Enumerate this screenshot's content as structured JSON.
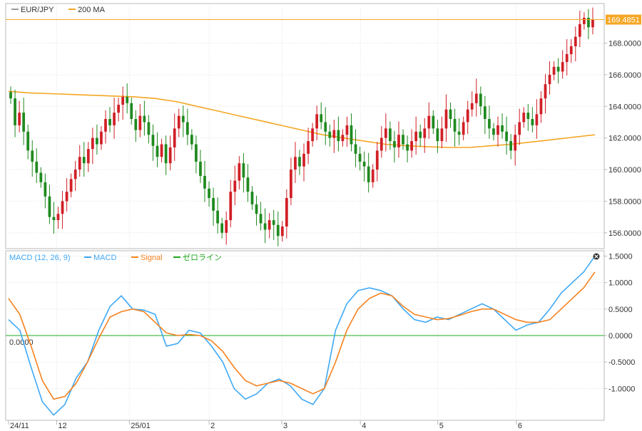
{
  "colors": {
    "background": "#ffffff",
    "grid": "#e0e0e0",
    "border": "#b8b8b8",
    "candle_up": "#d11f26",
    "candle_down": "#1f8a1f",
    "ma": "#f5a623",
    "macd": "#3fa9f5",
    "signal": "#f58220",
    "zero": "#22aa22",
    "price_tag_bg": "#f5a623",
    "price_tag_fg": "#ffffff"
  },
  "chart_data": [
    {
      "type": "candlestick",
      "legend": [
        {
          "label": "EUR/JPY",
          "color": "#9a9a9a"
        },
        {
          "label": "200 MA",
          "color": "#f5a623"
        }
      ],
      "ylim": [
        155,
        170.5
      ],
      "yticks": [
        "168.0000",
        "166.0000",
        "164.0000",
        "162.0000",
        "160.0000",
        "158.0000",
        "156.0000"
      ],
      "ytick_values": [
        168,
        166,
        164,
        162,
        160,
        158,
        156
      ],
      "last_price": "169.4851",
      "last_price_value": 169.4851,
      "closes": [
        164.5,
        162.8,
        163.6,
        162.4,
        161.2,
        160.5,
        159.8,
        159.2,
        158.3,
        157.0,
        156.8,
        157.2,
        158.0,
        158.6,
        159.4,
        160.0,
        160.8,
        160.4,
        161.3,
        162.0,
        161.6,
        162.4,
        163.2,
        162.8,
        163.6,
        164.1,
        164.6,
        164.2,
        163.2,
        162.5,
        163.4,
        163.0,
        162.2,
        161.5,
        160.8,
        161.6,
        160.4,
        161.4,
        162.6,
        163.4,
        163.0,
        162.2,
        161.6,
        160.5,
        159.6,
        158.8,
        158.2,
        157.4,
        156.6,
        156.0,
        156.8,
        158.6,
        159.3,
        160.4,
        159.5,
        158.6,
        157.8,
        157.2,
        156.6,
        156.2,
        156.8,
        156.5,
        155.8,
        156.4,
        158.2,
        160.0,
        160.8,
        160.2,
        161.0,
        161.8,
        162.6,
        163.5,
        163.0,
        162.4,
        162.0,
        162.5,
        161.8,
        162.2,
        162.8,
        161.6,
        161.0,
        160.5,
        160.2,
        159.2,
        160.0,
        161.2,
        162.0,
        162.6,
        161.8,
        161.4,
        162.2,
        161.6,
        161.2,
        161.8,
        162.4,
        162.0,
        162.6,
        163.4,
        162.6,
        161.8,
        162.6,
        163.8,
        163.2,
        162.4,
        162.2,
        163.0,
        163.8,
        164.2,
        164.8,
        164.0,
        163.2,
        162.6,
        162.2,
        162.8,
        162.4,
        161.8,
        161.2,
        162.2,
        163.0,
        163.6,
        163.2,
        162.8,
        163.5,
        164.5,
        165.4,
        166.0,
        166.5,
        166.2,
        166.8,
        167.3,
        167.8,
        168.4,
        169.2,
        169.6,
        169.0,
        169.5
      ],
      "ma_values": [
        164.95,
        164.85,
        164.8,
        164.75,
        164.7,
        164.65,
        164.6,
        164.5,
        164.3,
        164.0,
        163.7,
        163.4,
        163.1,
        162.8,
        162.5,
        162.2,
        162.0,
        161.8,
        161.6,
        161.5,
        161.45,
        161.4,
        161.4,
        161.5,
        161.6,
        161.75,
        161.9,
        162.05,
        162.2
      ],
      "ma_x_step": 5
    },
    {
      "type": "line",
      "legend": [
        {
          "label": "MACD (12, 26, 9)",
          "color": "#3fa9f5"
        },
        {
          "label": "MACD",
          "color": "#3fa9f5"
        },
        {
          "label": "Signal",
          "color": "#f58220"
        },
        {
          "label": "ゼロライン",
          "color": "#22aa22"
        }
      ],
      "ylim": [
        -1.6,
        1.6
      ],
      "yticks": [
        "1.5000",
        "1.0000",
        "0.5000",
        "0.0000",
        "-0.5000",
        "-1.0000"
      ],
      "ytick_values": [
        1.5,
        1.0,
        0.5,
        0.0,
        -0.5,
        -1.0
      ],
      "zero_label": "0.0000",
      "series": [
        {
          "name": "MACD",
          "values": [
            0.3,
            0.1,
            -0.6,
            -1.25,
            -1.5,
            -1.3,
            -0.8,
            -0.5,
            0.1,
            0.55,
            0.75,
            0.5,
            0.48,
            0.4,
            -0.2,
            -0.15,
            0.1,
            0.05,
            -0.2,
            -0.5,
            -1.0,
            -1.2,
            -1.1,
            -0.9,
            -0.82,
            -0.95,
            -1.2,
            -1.3,
            -1.0,
            0.1,
            0.6,
            0.85,
            0.9,
            0.85,
            0.75,
            0.5,
            0.3,
            0.25,
            0.35,
            0.3,
            0.4,
            0.5,
            0.6,
            0.5,
            0.3,
            0.1,
            0.2,
            0.25,
            0.5,
            0.8,
            1.0,
            1.2,
            1.5
          ]
        },
        {
          "name": "Signal",
          "values": [
            0.7,
            0.4,
            -0.2,
            -0.85,
            -1.2,
            -1.15,
            -0.9,
            -0.5,
            -0.05,
            0.35,
            0.45,
            0.5,
            0.45,
            0.25,
            0.05,
            0.0,
            0.02,
            0.0,
            -0.1,
            -0.3,
            -0.6,
            -0.85,
            -0.95,
            -0.9,
            -0.85,
            -0.9,
            -1.0,
            -1.1,
            -1.0,
            -0.5,
            0.1,
            0.5,
            0.7,
            0.8,
            0.75,
            0.55,
            0.4,
            0.35,
            0.3,
            0.32,
            0.38,
            0.45,
            0.5,
            0.5,
            0.4,
            0.3,
            0.25,
            0.25,
            0.3,
            0.5,
            0.7,
            0.9,
            1.2
          ]
        }
      ]
    }
  ],
  "x_axis": {
    "labels": [
      {
        "text": "24/11",
        "pos": 0.0
      },
      {
        "text": "12",
        "pos": 0.082
      },
      {
        "text": "25/01",
        "pos": 0.206
      },
      {
        "text": "2",
        "pos": 0.342
      },
      {
        "text": "3",
        "pos": 0.466
      },
      {
        "text": "4",
        "pos": 0.6
      },
      {
        "text": "5",
        "pos": 0.732
      },
      {
        "text": "6",
        "pos": 0.866
      }
    ]
  },
  "close_icon": "circle-x-icon"
}
